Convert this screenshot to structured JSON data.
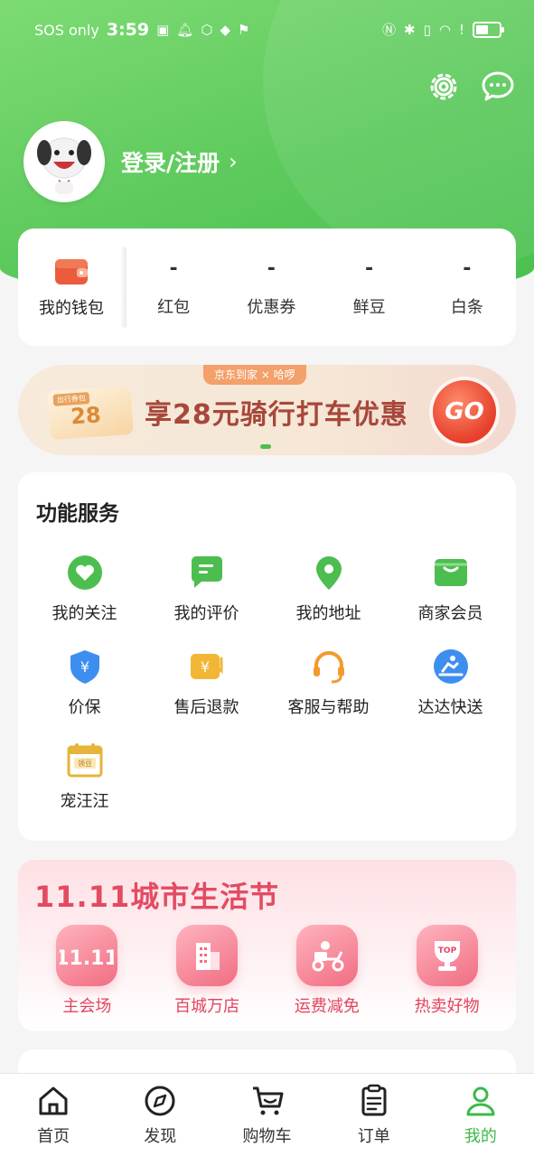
{
  "status_bar": {
    "carrier": "SOS only",
    "time": "3:59",
    "battery_level": 0.55
  },
  "profile": {
    "login_text": "登录/注册",
    "chevron": "›"
  },
  "wallet": {
    "label": "我的钱包",
    "stats": [
      {
        "value": "-",
        "label": "红包"
      },
      {
        "value": "-",
        "label": "优惠券"
      },
      {
        "value": "-",
        "label": "鲜豆"
      },
      {
        "value": "-",
        "label": "白条"
      }
    ]
  },
  "banner": {
    "top_tag": "京东到家 × 哈啰",
    "coupon_tag": "出行券包",
    "coupon_value": "28",
    "text": "享28元骑行打车优惠",
    "button": "GO"
  },
  "services": {
    "title": "功能服务",
    "items": [
      {
        "label": "我的关注",
        "icon": "heart-icon"
      },
      {
        "label": "我的评价",
        "icon": "comment-icon"
      },
      {
        "label": "我的地址",
        "icon": "location-icon"
      },
      {
        "label": "商家会员",
        "icon": "wallet-card-icon"
      },
      {
        "label": "价保",
        "icon": "price-shield-icon"
      },
      {
        "label": "售后退款",
        "icon": "refund-icon"
      },
      {
        "label": "客服与帮助",
        "icon": "headset-icon"
      },
      {
        "label": "达达快送",
        "icon": "delivery-icon"
      },
      {
        "label": "宠汪汪",
        "icon": "calendar-icon",
        "badge": "领豆"
      }
    ]
  },
  "festival": {
    "title": "11.11城市生活节",
    "items": [
      {
        "label": "主会场",
        "icon": "main-venue-icon",
        "text": "11.11"
      },
      {
        "label": "百城万店",
        "icon": "building-icon"
      },
      {
        "label": "运费减免",
        "icon": "scooter-icon"
      },
      {
        "label": "热卖好物",
        "icon": "trophy-icon",
        "text": "TOP"
      }
    ]
  },
  "tabbar": {
    "items": [
      {
        "label": "首页",
        "icon": "home-icon"
      },
      {
        "label": "发现",
        "icon": "compass-icon"
      },
      {
        "label": "购物车",
        "icon": "cart-icon"
      },
      {
        "label": "订单",
        "icon": "order-icon"
      },
      {
        "label": "我的",
        "icon": "user-icon",
        "active": true
      }
    ]
  },
  "colors": {
    "primary_green": "#4cbe4f",
    "festival_red": "#e34b63",
    "banner_text": "#a7473a"
  }
}
